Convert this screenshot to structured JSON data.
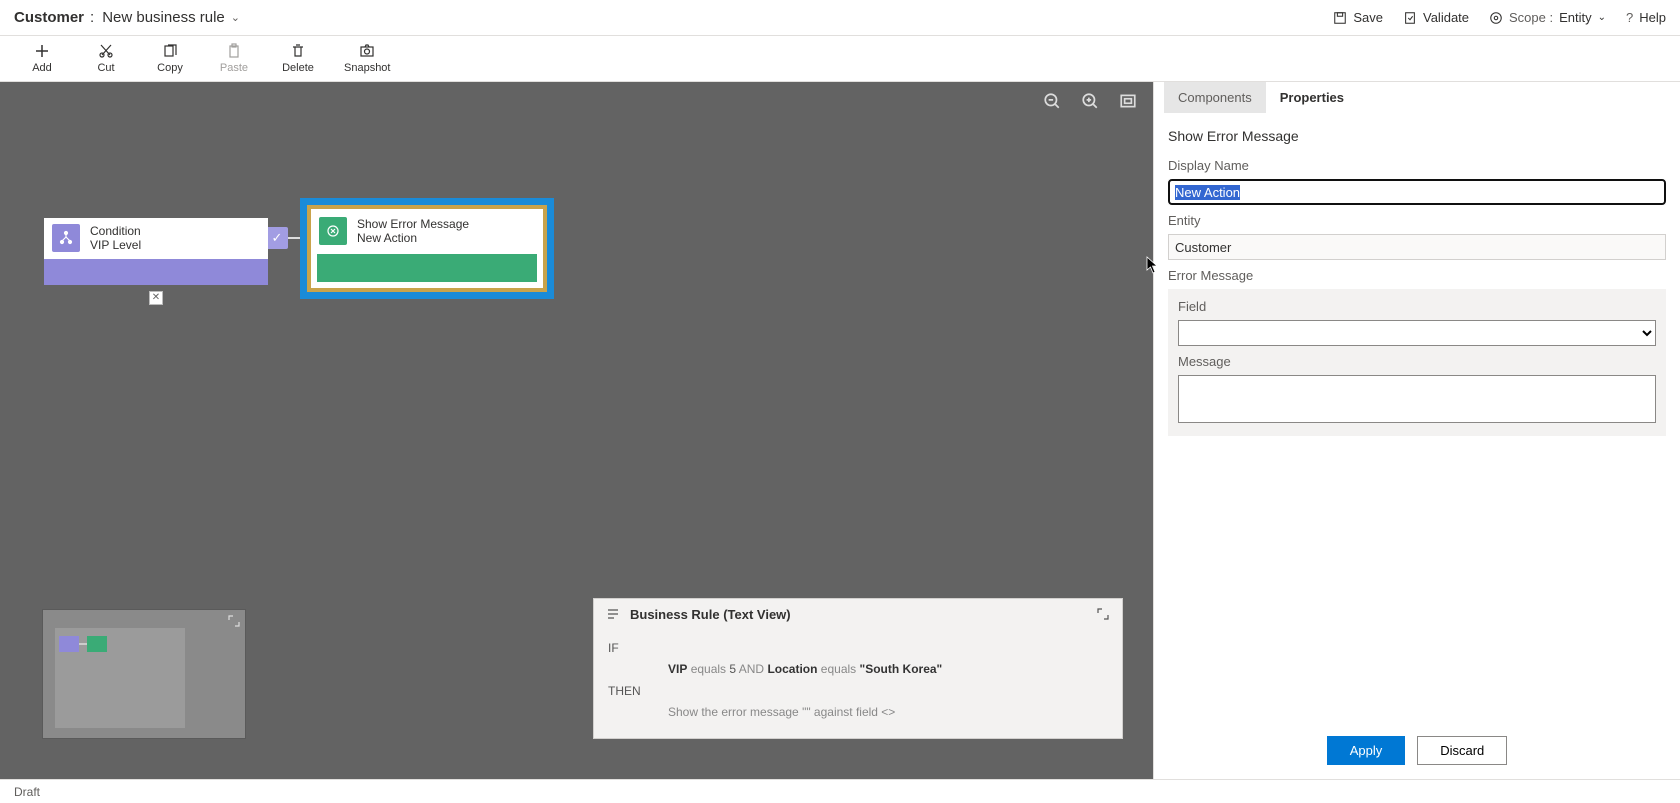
{
  "title": {
    "entity": "Customer",
    "name": "New business rule"
  },
  "topActions": {
    "save": "Save",
    "validate": "Validate",
    "scopeLabel": "Scope :",
    "scopeValue": "Entity",
    "help": "Help"
  },
  "toolbar": {
    "add": "Add",
    "cut": "Cut",
    "copy": "Copy",
    "paste": "Paste",
    "delete": "Delete",
    "snapshot": "Snapshot"
  },
  "canvas": {
    "condition": {
      "type": "Condition",
      "name": "VIP Level"
    },
    "action": {
      "type": "Show Error Message",
      "name": "New Action"
    }
  },
  "textView": {
    "title": "Business Rule (Text View)",
    "ifKw": "IF",
    "thenKw": "THEN",
    "f1": "VIP",
    "op1": "equals",
    "v1": "5",
    "and": "AND",
    "f2": "Location",
    "op2": "equals",
    "v2": "\"South Korea\"",
    "thenText": "Show the error message \"\" against field <>"
  },
  "properties": {
    "tabs": {
      "components": "Components",
      "properties": "Properties"
    },
    "title": "Show Error Message",
    "displayNameLabel": "Display Name",
    "displayNameValue": "New Action",
    "entityLabel": "Entity",
    "entityValue": "Customer",
    "errorMessageLabel": "Error Message",
    "fieldLabel": "Field",
    "fieldValue": "",
    "messageLabel": "Message",
    "messageValue": "",
    "applyLabel": "Apply",
    "discardLabel": "Discard"
  },
  "status": {
    "draft": "Draft"
  }
}
